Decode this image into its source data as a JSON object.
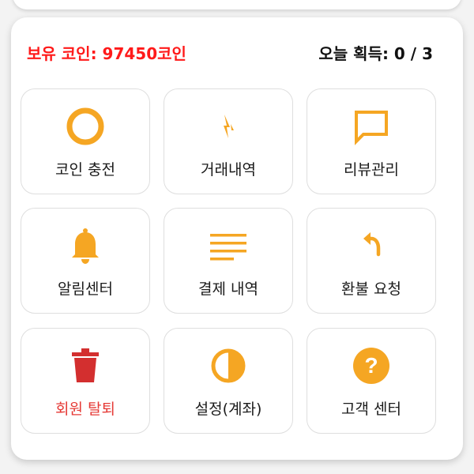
{
  "header": {
    "coin_balance": "보유 코인: 97450코인",
    "today_earned": "오늘 획득: 0 / 3"
  },
  "colors": {
    "accent": "#f5a623",
    "danger_icon": "#d32f2f",
    "danger_label": "#e53935",
    "balance_text": "#ff1a1a"
  },
  "menu": [
    {
      "label": "코인 충전",
      "icon": "coin-circle-icon"
    },
    {
      "label": "거래내역",
      "icon": "transaction-bolt-icon"
    },
    {
      "label": "리뷰관리",
      "icon": "chat-bubble-icon"
    },
    {
      "label": "알림센터",
      "icon": "bell-icon"
    },
    {
      "label": "결제 내역",
      "icon": "list-lines-icon"
    },
    {
      "label": "환불 요청",
      "icon": "undo-arrow-icon"
    },
    {
      "label": "회원 탈퇴",
      "icon": "trash-icon"
    },
    {
      "label": "설정(계좌)",
      "icon": "half-circle-icon"
    },
    {
      "label": "고객 센터",
      "icon": "help-circle-icon"
    }
  ]
}
